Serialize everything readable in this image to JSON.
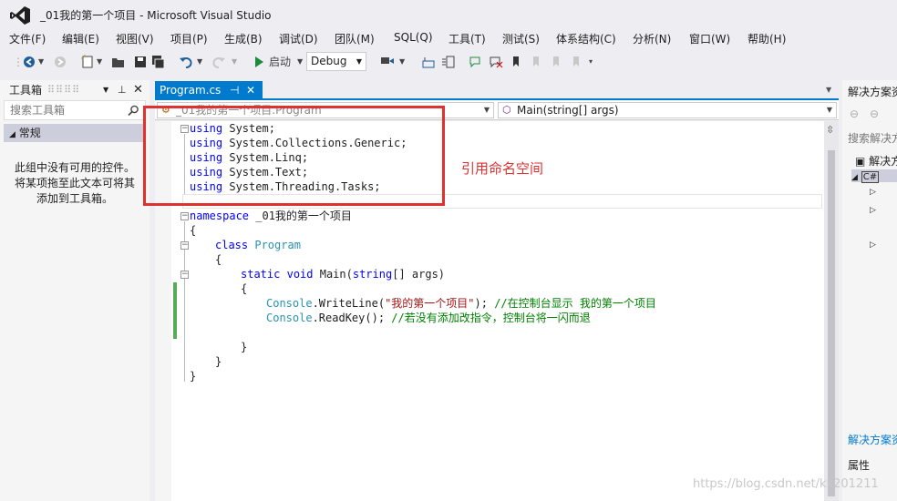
{
  "window": {
    "title": "_01我的第一个项目 - Microsoft Visual Studio"
  },
  "menu": [
    "文件(F)",
    "编辑(E)",
    "视图(V)",
    "项目(P)",
    "生成(B)",
    "调试(D)",
    "团队(M)",
    "SQL(Q)",
    "工具(T)",
    "测试(S)",
    "体系结构(C)",
    "分析(N)",
    "窗口(W)",
    "帮助(H)"
  ],
  "toolbar": {
    "start_label": "启动",
    "config_value": "Debug"
  },
  "toolbox": {
    "title": "工具箱",
    "search_placeholder": "搜索工具箱",
    "group_name": "常规",
    "empty_line1": "此组中没有可用的控件。",
    "empty_line2": "将某项拖至此文本可将其",
    "empty_line3": "添加到工具箱。"
  },
  "editor": {
    "tab_label": "Program.cs",
    "nav_class": "_01我的第一个项目.Program",
    "nav_member": "Main(string[] args)",
    "using_lines": [
      "System;",
      "System.Collections.Generic;",
      "System.Linq;",
      "System.Text;",
      "System.Threading.Tasks;"
    ],
    "kw_using": "using",
    "kw_namespace": "namespace",
    "namespace_name": " _01我的第一个项目",
    "kw_class": "class",
    "class_name": "Program",
    "kw_static": "static",
    "kw_void": "void",
    "main_sig": " Main(",
    "kw_string": "string",
    "main_args": "[] args)",
    "console_type": "Console",
    "writeline_call": ".WriteLine(",
    "writeline_string": "\"我的第一个项目\"",
    "writeline_end": "); ",
    "writeline_comment": "//在控制台显示 我的第一个项目",
    "readkey_call": ".ReadKey(); ",
    "readkey_comment": "//若没有添加改指令，控制台将一闪而退",
    "brace_open": "{",
    "brace_close": "}"
  },
  "annotation": {
    "text": "引用命名空间",
    "color": "#e03131"
  },
  "solution_explorer": {
    "title": "解决方案资源管理器",
    "search_placeholder": "搜索解决方案资源管理器",
    "root_label": "解决方案",
    "footer_link": "解决方案资源管理器",
    "properties_title": "属性"
  },
  "watermark": "https://blog.csdn.net/kk201211",
  "colors": {
    "accent": "#007acc",
    "keyword": "#0000ff",
    "type": "#2b91af",
    "string": "#a31515",
    "comment": "#008000"
  }
}
